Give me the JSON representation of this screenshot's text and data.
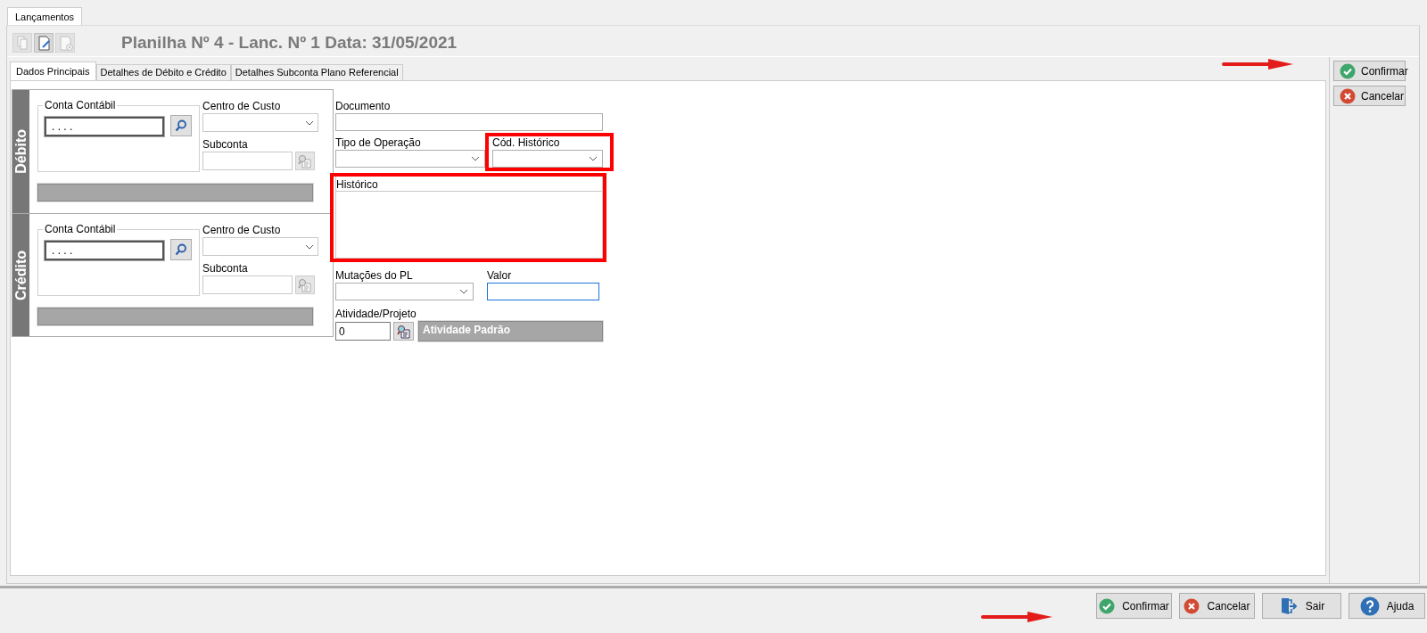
{
  "window_tabs": [
    {
      "label": "Lançamentos",
      "selected": true
    }
  ],
  "toolbar": {
    "buttons": [
      {
        "kind": "copy",
        "disabled": true
      },
      {
        "kind": "edit",
        "disabled": false
      },
      {
        "kind": "delete",
        "disabled": true
      }
    ],
    "title": "Planilha Nº 4 - Lanc. Nº 1 Data: 31/05/2021"
  },
  "page_tabs": [
    {
      "label": "Dados Principais",
      "selected": true
    },
    {
      "label": "Detalhes de Débito e Crédito",
      "selected": false
    },
    {
      "label": "Detalhes Subconta Plano Referencial",
      "selected": false
    }
  ],
  "sections": [
    {
      "title": "Débito",
      "account_label": "Conta Contábil",
      "account_value": ". . . .",
      "cost_center_label": "Centro de Custo",
      "subaccount_label": "Subconta"
    },
    {
      "title": "Crédito",
      "account_label": "Conta Contábil",
      "account_value": ". . . .",
      "cost_center_label": "Centro de Custo",
      "subaccount_label": "Subconta"
    }
  ],
  "form": {
    "document": {
      "label": "Documento"
    },
    "operation_type": {
      "label": "Tipo de Operação"
    },
    "history_code": {
      "label": "Cód. Histórico",
      "highlighted": true
    },
    "history": {
      "label": "Histórico",
      "highlighted": true
    },
    "equity_changes": {
      "label": "Mutações do PL"
    },
    "amount": {
      "label": "Valor",
      "focused": true
    },
    "activity": {
      "label": "Atividade/Projeto",
      "value": "0",
      "name": "Atividade Padrão"
    }
  },
  "side_buttons": [
    {
      "kind": "confirm",
      "label": "Confirmar"
    },
    {
      "kind": "cancel",
      "label": "Cancelar"
    }
  ],
  "bottom_buttons": [
    {
      "kind": "confirm",
      "label": "Confirmar"
    },
    {
      "kind": "cancel",
      "label": "Cancelar"
    },
    {
      "kind": "exit",
      "label": "Sair"
    },
    {
      "kind": "help",
      "label": "Ajuda"
    }
  ]
}
